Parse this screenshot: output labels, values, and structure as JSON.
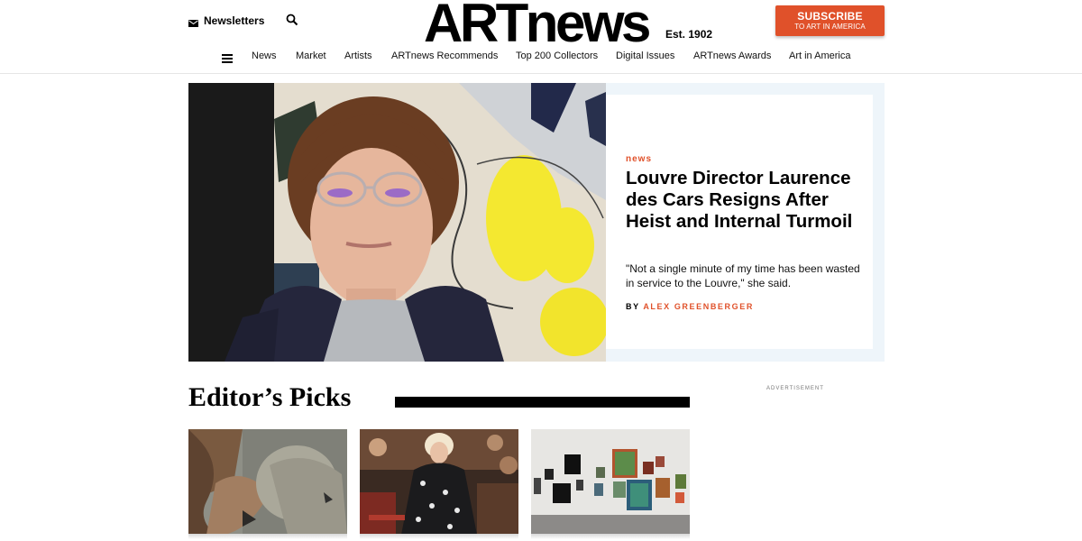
{
  "header": {
    "newsletters_label": "Newsletters",
    "logo_text": "ARTnews",
    "est_text": "Est. 1902",
    "subscribe_label": "SUBSCRIBE",
    "subscribe_sublabel": "TO ART IN AMERICA",
    "icons": [
      "mail-icon",
      "search-icon",
      "menu-icon"
    ]
  },
  "nav": {
    "items": [
      {
        "label": "News"
      },
      {
        "label": "Market"
      },
      {
        "label": "Artists"
      },
      {
        "label": "ARTnews Recommends"
      },
      {
        "label": "Top 200 Collectors"
      },
      {
        "label": "Digital Issues"
      },
      {
        "label": "ARTnews Awards"
      },
      {
        "label": "Art in America"
      }
    ]
  },
  "hero": {
    "kicker": "news",
    "headline": "Louvre Director Laurence des Cars Resigns After Heist and Internal Turmoil",
    "dek": "\"Not a single minute of my time has been wasted in service to the Louvre,\" she said.",
    "byline_prefix": "BY",
    "author": "ALEX GREENBERGER"
  },
  "editors_picks": {
    "title": "Editor’s Picks",
    "advertisement_label": "ADVERTISEMENT"
  },
  "colors": {
    "accent": "#e0512a",
    "hero_bg": "#eef5fa",
    "text": "#000000"
  }
}
